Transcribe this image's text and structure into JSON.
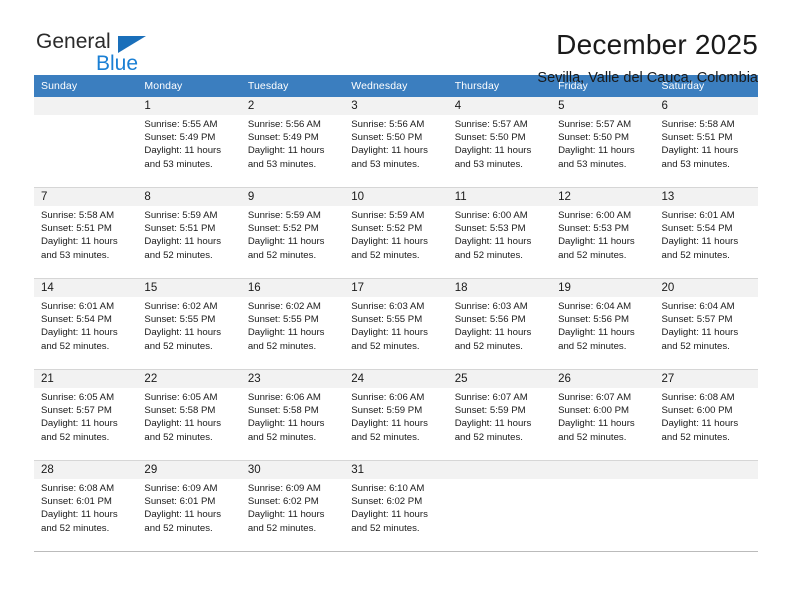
{
  "brand": {
    "name_part1": "General",
    "name_part2": "Blue",
    "triangle_color": "#1a6fba",
    "blue_color": "#1a7fd4"
  },
  "header": {
    "title": "December 2025",
    "subtitle": "Sevilla, Valle del Cauca, Colombia"
  },
  "colors": {
    "header_row_bg": "#3b7ebf",
    "header_row_text": "#ffffff",
    "daynum_bg": "#f2f2f2",
    "grid_line": "#3b7ebf",
    "text": "#1a1a1a"
  },
  "weekday_headers": [
    "Sunday",
    "Monday",
    "Tuesday",
    "Wednesday",
    "Thursday",
    "Friday",
    "Saturday"
  ],
  "weeks": [
    [
      {
        "day": "",
        "sunrise": "",
        "sunset": "",
        "daylight_line1": "",
        "daylight_line2": ""
      },
      {
        "day": "1",
        "sunrise": "Sunrise: 5:55 AM",
        "sunset": "Sunset: 5:49 PM",
        "daylight_line1": "Daylight: 11 hours",
        "daylight_line2": "and 53 minutes."
      },
      {
        "day": "2",
        "sunrise": "Sunrise: 5:56 AM",
        "sunset": "Sunset: 5:49 PM",
        "daylight_line1": "Daylight: 11 hours",
        "daylight_line2": "and 53 minutes."
      },
      {
        "day": "3",
        "sunrise": "Sunrise: 5:56 AM",
        "sunset": "Sunset: 5:50 PM",
        "daylight_line1": "Daylight: 11 hours",
        "daylight_line2": "and 53 minutes."
      },
      {
        "day": "4",
        "sunrise": "Sunrise: 5:57 AM",
        "sunset": "Sunset: 5:50 PM",
        "daylight_line1": "Daylight: 11 hours",
        "daylight_line2": "and 53 minutes."
      },
      {
        "day": "5",
        "sunrise": "Sunrise: 5:57 AM",
        "sunset": "Sunset: 5:50 PM",
        "daylight_line1": "Daylight: 11 hours",
        "daylight_line2": "and 53 minutes."
      },
      {
        "day": "6",
        "sunrise": "Sunrise: 5:58 AM",
        "sunset": "Sunset: 5:51 PM",
        "daylight_line1": "Daylight: 11 hours",
        "daylight_line2": "and 53 minutes."
      }
    ],
    [
      {
        "day": "7",
        "sunrise": "Sunrise: 5:58 AM",
        "sunset": "Sunset: 5:51 PM",
        "daylight_line1": "Daylight: 11 hours",
        "daylight_line2": "and 53 minutes."
      },
      {
        "day": "8",
        "sunrise": "Sunrise: 5:59 AM",
        "sunset": "Sunset: 5:51 PM",
        "daylight_line1": "Daylight: 11 hours",
        "daylight_line2": "and 52 minutes."
      },
      {
        "day": "9",
        "sunrise": "Sunrise: 5:59 AM",
        "sunset": "Sunset: 5:52 PM",
        "daylight_line1": "Daylight: 11 hours",
        "daylight_line2": "and 52 minutes."
      },
      {
        "day": "10",
        "sunrise": "Sunrise: 5:59 AM",
        "sunset": "Sunset: 5:52 PM",
        "daylight_line1": "Daylight: 11 hours",
        "daylight_line2": "and 52 minutes."
      },
      {
        "day": "11",
        "sunrise": "Sunrise: 6:00 AM",
        "sunset": "Sunset: 5:53 PM",
        "daylight_line1": "Daylight: 11 hours",
        "daylight_line2": "and 52 minutes."
      },
      {
        "day": "12",
        "sunrise": "Sunrise: 6:00 AM",
        "sunset": "Sunset: 5:53 PM",
        "daylight_line1": "Daylight: 11 hours",
        "daylight_line2": "and 52 minutes."
      },
      {
        "day": "13",
        "sunrise": "Sunrise: 6:01 AM",
        "sunset": "Sunset: 5:54 PM",
        "daylight_line1": "Daylight: 11 hours",
        "daylight_line2": "and 52 minutes."
      }
    ],
    [
      {
        "day": "14",
        "sunrise": "Sunrise: 6:01 AM",
        "sunset": "Sunset: 5:54 PM",
        "daylight_line1": "Daylight: 11 hours",
        "daylight_line2": "and 52 minutes."
      },
      {
        "day": "15",
        "sunrise": "Sunrise: 6:02 AM",
        "sunset": "Sunset: 5:55 PM",
        "daylight_line1": "Daylight: 11 hours",
        "daylight_line2": "and 52 minutes."
      },
      {
        "day": "16",
        "sunrise": "Sunrise: 6:02 AM",
        "sunset": "Sunset: 5:55 PM",
        "daylight_line1": "Daylight: 11 hours",
        "daylight_line2": "and 52 minutes."
      },
      {
        "day": "17",
        "sunrise": "Sunrise: 6:03 AM",
        "sunset": "Sunset: 5:55 PM",
        "daylight_line1": "Daylight: 11 hours",
        "daylight_line2": "and 52 minutes."
      },
      {
        "day": "18",
        "sunrise": "Sunrise: 6:03 AM",
        "sunset": "Sunset: 5:56 PM",
        "daylight_line1": "Daylight: 11 hours",
        "daylight_line2": "and 52 minutes."
      },
      {
        "day": "19",
        "sunrise": "Sunrise: 6:04 AM",
        "sunset": "Sunset: 5:56 PM",
        "daylight_line1": "Daylight: 11 hours",
        "daylight_line2": "and 52 minutes."
      },
      {
        "day": "20",
        "sunrise": "Sunrise: 6:04 AM",
        "sunset": "Sunset: 5:57 PM",
        "daylight_line1": "Daylight: 11 hours",
        "daylight_line2": "and 52 minutes."
      }
    ],
    [
      {
        "day": "21",
        "sunrise": "Sunrise: 6:05 AM",
        "sunset": "Sunset: 5:57 PM",
        "daylight_line1": "Daylight: 11 hours",
        "daylight_line2": "and 52 minutes."
      },
      {
        "day": "22",
        "sunrise": "Sunrise: 6:05 AM",
        "sunset": "Sunset: 5:58 PM",
        "daylight_line1": "Daylight: 11 hours",
        "daylight_line2": "and 52 minutes."
      },
      {
        "day": "23",
        "sunrise": "Sunrise: 6:06 AM",
        "sunset": "Sunset: 5:58 PM",
        "daylight_line1": "Daylight: 11 hours",
        "daylight_line2": "and 52 minutes."
      },
      {
        "day": "24",
        "sunrise": "Sunrise: 6:06 AM",
        "sunset": "Sunset: 5:59 PM",
        "daylight_line1": "Daylight: 11 hours",
        "daylight_line2": "and 52 minutes."
      },
      {
        "day": "25",
        "sunrise": "Sunrise: 6:07 AM",
        "sunset": "Sunset: 5:59 PM",
        "daylight_line1": "Daylight: 11 hours",
        "daylight_line2": "and 52 minutes."
      },
      {
        "day": "26",
        "sunrise": "Sunrise: 6:07 AM",
        "sunset": "Sunset: 6:00 PM",
        "daylight_line1": "Daylight: 11 hours",
        "daylight_line2": "and 52 minutes."
      },
      {
        "day": "27",
        "sunrise": "Sunrise: 6:08 AM",
        "sunset": "Sunset: 6:00 PM",
        "daylight_line1": "Daylight: 11 hours",
        "daylight_line2": "and 52 minutes."
      }
    ],
    [
      {
        "day": "28",
        "sunrise": "Sunrise: 6:08 AM",
        "sunset": "Sunset: 6:01 PM",
        "daylight_line1": "Daylight: 11 hours",
        "daylight_line2": "and 52 minutes."
      },
      {
        "day": "29",
        "sunrise": "Sunrise: 6:09 AM",
        "sunset": "Sunset: 6:01 PM",
        "daylight_line1": "Daylight: 11 hours",
        "daylight_line2": "and 52 minutes."
      },
      {
        "day": "30",
        "sunrise": "Sunrise: 6:09 AM",
        "sunset": "Sunset: 6:02 PM",
        "daylight_line1": "Daylight: 11 hours",
        "daylight_line2": "and 52 minutes."
      },
      {
        "day": "31",
        "sunrise": "Sunrise: 6:10 AM",
        "sunset": "Sunset: 6:02 PM",
        "daylight_line1": "Daylight: 11 hours",
        "daylight_line2": "and 52 minutes."
      },
      {
        "day": "",
        "sunrise": "",
        "sunset": "",
        "daylight_line1": "",
        "daylight_line2": ""
      },
      {
        "day": "",
        "sunrise": "",
        "sunset": "",
        "daylight_line1": "",
        "daylight_line2": ""
      },
      {
        "day": "",
        "sunrise": "",
        "sunset": "",
        "daylight_line1": "",
        "daylight_line2": ""
      }
    ]
  ]
}
